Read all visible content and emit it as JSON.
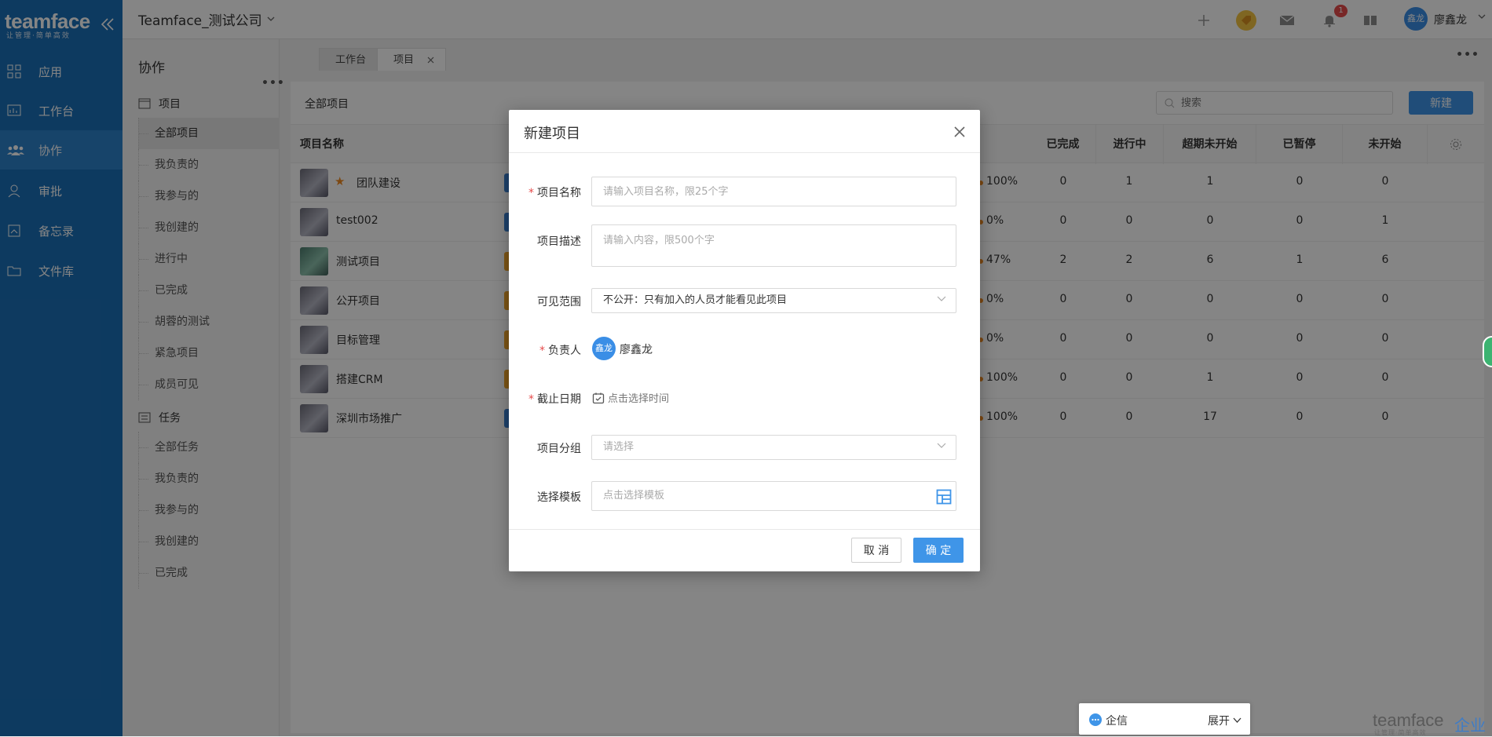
{
  "app": {
    "logo": "teamface",
    "logo_sub": "让管理·简单高效",
    "company": "Teamface_测试公司",
    "user_avatar": "鑫龙",
    "user_name": "廖鑫龙",
    "notification_count": "1"
  },
  "rail": [
    {
      "label": "应用",
      "icon": "grid-icon"
    },
    {
      "label": "工作台",
      "icon": "dashboard-icon"
    },
    {
      "label": "协作",
      "icon": "team-icon"
    },
    {
      "label": "审批",
      "icon": "person-icon"
    },
    {
      "label": "备忘录",
      "icon": "memo-icon"
    },
    {
      "label": "文件库",
      "icon": "folder-icon"
    }
  ],
  "sidebar": {
    "title": "协作",
    "project_group": "项目",
    "project_items": [
      "全部项目",
      "我负责的",
      "我参与的",
      "我创建的",
      "进行中",
      "已完成",
      "胡蓉的测试",
      "紧急项目",
      "成员可见"
    ],
    "task_group": "任务",
    "task_items": [
      "全部任务",
      "我负责的",
      "我参与的",
      "我创建的",
      "已完成"
    ]
  },
  "tabs": [
    "工作台",
    "项目"
  ],
  "panel": {
    "title": "全部项目",
    "search_placeholder": "搜索",
    "new_button": "新建"
  },
  "table": {
    "columns": [
      "项目名称",
      "已完成",
      "进行中",
      "超期未开始",
      "已暂停",
      "未开始"
    ],
    "rows": [
      {
        "name": "团队建设",
        "starred": true,
        "tag": "#3a7fd0",
        "pct": "100%",
        "done": "0",
        "doing": "1",
        "overdue": "1",
        "paused": "0",
        "notstarted": "0",
        "thumb": "a"
      },
      {
        "name": "test002",
        "starred": false,
        "tag": "#3a7fd0",
        "pct": "0%",
        "done": "0",
        "doing": "0",
        "overdue": "0",
        "paused": "0",
        "notstarted": "1",
        "thumb": "a"
      },
      {
        "name": "测试项目",
        "starred": false,
        "tag": "#f0a52b",
        "pct": "47%",
        "done": "2",
        "doing": "2",
        "overdue": "6",
        "paused": "1",
        "notstarted": "6",
        "thumb": "g"
      },
      {
        "name": "公开项目",
        "starred": false,
        "tag": "#f0a52b",
        "pct": "0%",
        "done": "0",
        "doing": "0",
        "overdue": "0",
        "paused": "0",
        "notstarted": "0",
        "thumb": "a"
      },
      {
        "name": "目标管理",
        "starred": false,
        "tag": "#f0a52b",
        "pct": "0%",
        "done": "0",
        "doing": "0",
        "overdue": "0",
        "paused": "0",
        "notstarted": "0",
        "thumb": "a"
      },
      {
        "name": "搭建CRM",
        "starred": false,
        "tag": "#f0a52b",
        "pct": "100%",
        "done": "0",
        "doing": "0",
        "overdue": "1",
        "paused": "0",
        "notstarted": "0",
        "thumb": "a"
      },
      {
        "name": "深圳市场推广",
        "starred": false,
        "tag": "#3a7fd0",
        "pct": "100%",
        "done": "0",
        "doing": "0",
        "overdue": "17",
        "paused": "0",
        "notstarted": "0",
        "thumb": "a"
      }
    ]
  },
  "modal": {
    "title": "新建项目",
    "name_label": "项目名称",
    "name_placeholder": "请输入项目名称，限25个字",
    "desc_label": "项目描述",
    "desc_placeholder": "请输入内容，限500个字",
    "scope_label": "可见范围",
    "scope_value": "不公开：只有加入的人员才能看见此项目",
    "owner_label": "负责人",
    "owner_avatar": "鑫龙",
    "owner_name": "廖鑫龙",
    "deadline_label": "截止日期",
    "deadline_placeholder": "点击选择时间",
    "group_label": "项目分组",
    "group_placeholder": "请选择",
    "template_label": "选择模板",
    "template_placeholder": "点击选择模板",
    "cancel": "取 消",
    "ok": "确 定"
  },
  "chat": {
    "label": "企信",
    "expand": "展开"
  },
  "watermark": {
    "brand": "teamface",
    "sub": "让管理·简单高效",
    "extra": "企业"
  },
  "colors": {
    "rail_bg": "#1a6fb8",
    "primary": "#3f95e8",
    "required": "#e64b4b",
    "star": "#f08b22"
  }
}
